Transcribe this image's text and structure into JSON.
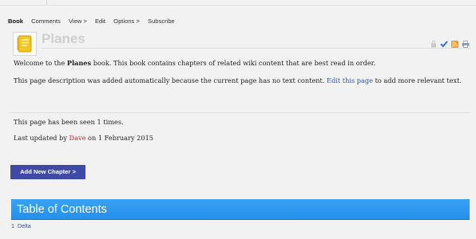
{
  "nav": {
    "items": [
      "Book",
      "Comments",
      "View >",
      "Edit",
      "Options >",
      "Subscribe"
    ],
    "active": "Book"
  },
  "header": {
    "title": "Planes",
    "icon": "book-icon",
    "accent": "#f3c623"
  },
  "actions": [
    {
      "icon": "lock-icon",
      "color": "#c8c8c8"
    },
    {
      "icon": "checkmark-icon",
      "color": "#3b6fd0"
    },
    {
      "icon": "rss-icon",
      "color": "#f39a2a"
    },
    {
      "icon": "print-icon",
      "color": "#8a9bb0"
    }
  ],
  "description": {
    "p1_before": "Welcome to the ",
    "p1_bold": "Planes",
    "p1_after": " book. This book contains chapters of related wiki content that are best read in order.",
    "p2_before": "This page description was added automatically because the current page has no text content. ",
    "p2_link": "Edit this page",
    "p2_after": " to add more relevant text."
  },
  "stats": {
    "seen": "This page has been seen 1 times.",
    "updated_before": "Last updated by ",
    "updated_user": "Dave",
    "updated_after": " on 1 February 2015"
  },
  "add_chapter_button": "Add New Chapter >",
  "toc": {
    "title": "Table of Contents",
    "items": [
      {
        "number": "1",
        "label": "Delta"
      }
    ]
  },
  "colors": {
    "link": "#2a56a6",
    "user_link": "#d4262a",
    "button": "#3f4aa8",
    "toc_bar": "#2a96ee"
  }
}
